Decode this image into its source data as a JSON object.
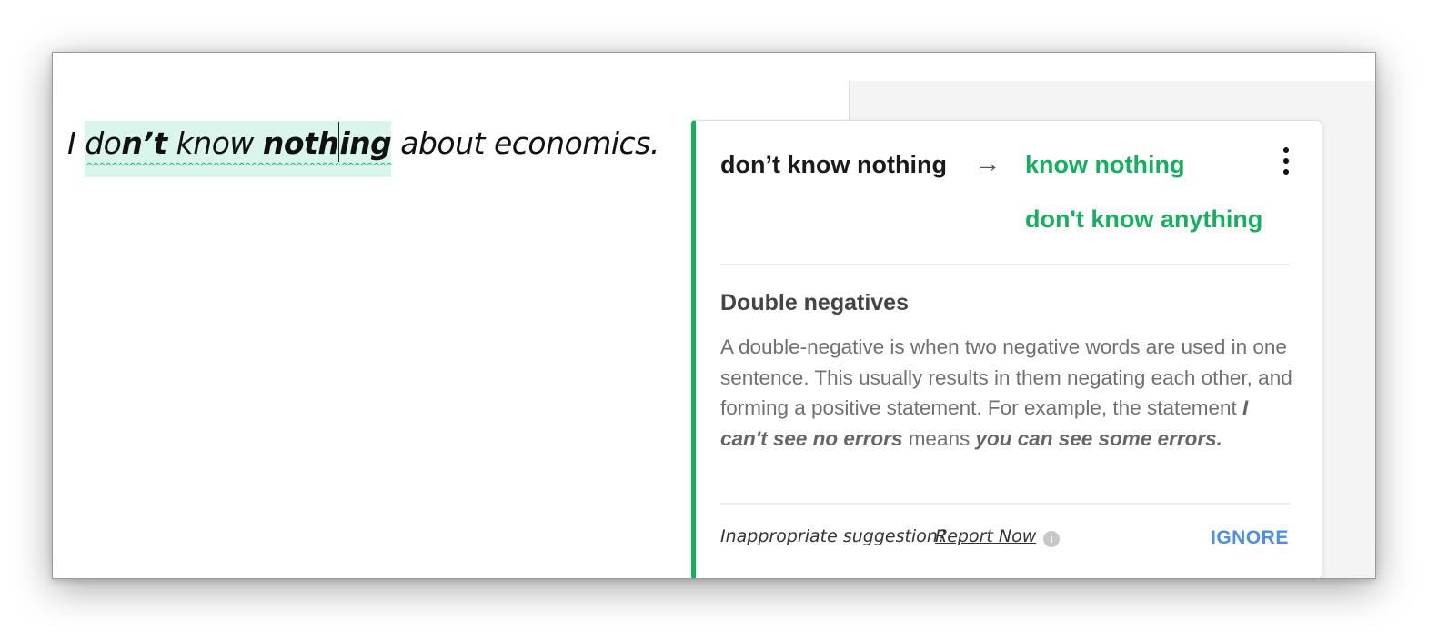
{
  "editor": {
    "before": "I ",
    "hl_a": "do",
    "hl_b": "n’t",
    "hl_c": " know ",
    "hl_d": "noth",
    "hl_e": "ing",
    "after": " about economics."
  },
  "card": {
    "original": "don’t know nothing",
    "arrow": "→",
    "suggestions": [
      "know nothing",
      "don't know anything"
    ],
    "rule_title": "Double negatives",
    "rule_body_1": "A double-negative is when two negative words are used in one sentence. This usually results in them negating each other, and forming a positive statement. For example, the statement ",
    "example_1": "I can't see no errors",
    "rule_body_2": " means ",
    "example_2": "you can see some errors.",
    "footer_question": "Inappropriate suggestion?",
    "report_link": "Report Now",
    "info_icon": "i",
    "ignore_label": "IGNORE"
  },
  "colors": {
    "accent_green": "#15b05f",
    "highlight": "#d9f5ec",
    "link_blue": "#4a90e2"
  },
  "icons": {
    "more": "more-vertical-icon",
    "info": "info-icon"
  }
}
